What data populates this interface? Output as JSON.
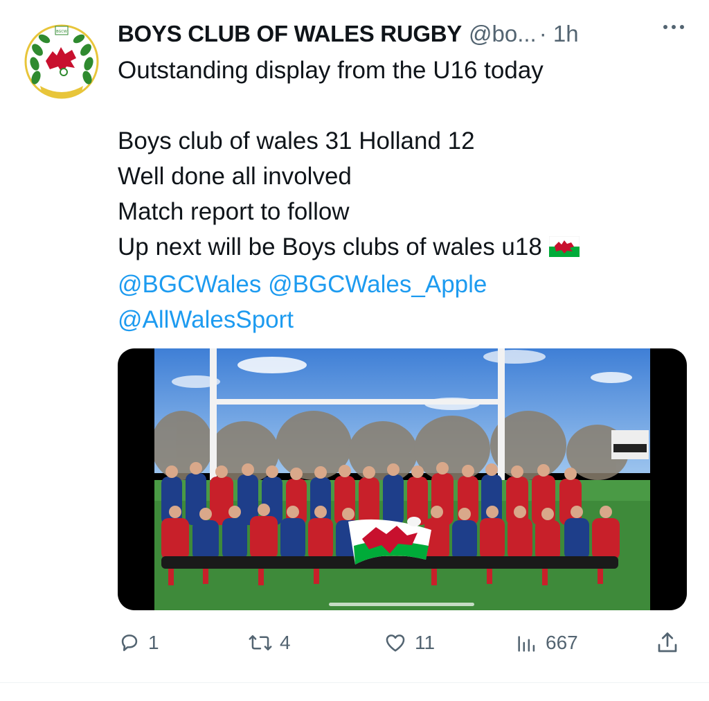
{
  "tweet": {
    "author_name": "BOYS CLUB OF WALES RUGBY",
    "author_handle": "@bo...",
    "timestamp": "· 1h",
    "text_lines": [
      "Outstanding display from the U16 today",
      "Boys club of wales 31 Holland 12",
      "Well done all involved",
      "Match report to follow",
      "Up next will be Boys clubs of wales u18"
    ],
    "mentions": [
      "@BGCWales",
      "@BGCWales_Apple",
      "@AllWalesSport"
    ],
    "avatar_text": "BGCW"
  },
  "actions": {
    "replies": "1",
    "retweets": "4",
    "likes": "11",
    "views": "667"
  },
  "icons": {
    "more": "more-icon",
    "reply": "reply-icon",
    "retweet": "retweet-icon",
    "like": "heart-icon",
    "views": "views-icon",
    "share": "share-icon",
    "flag": "wales-flag-emoji"
  },
  "colors": {
    "text": "#0f1419",
    "secondary": "#536471",
    "link": "#1d9bf0",
    "welsh_red": "#c8102e",
    "welsh_green": "#00ab39"
  }
}
